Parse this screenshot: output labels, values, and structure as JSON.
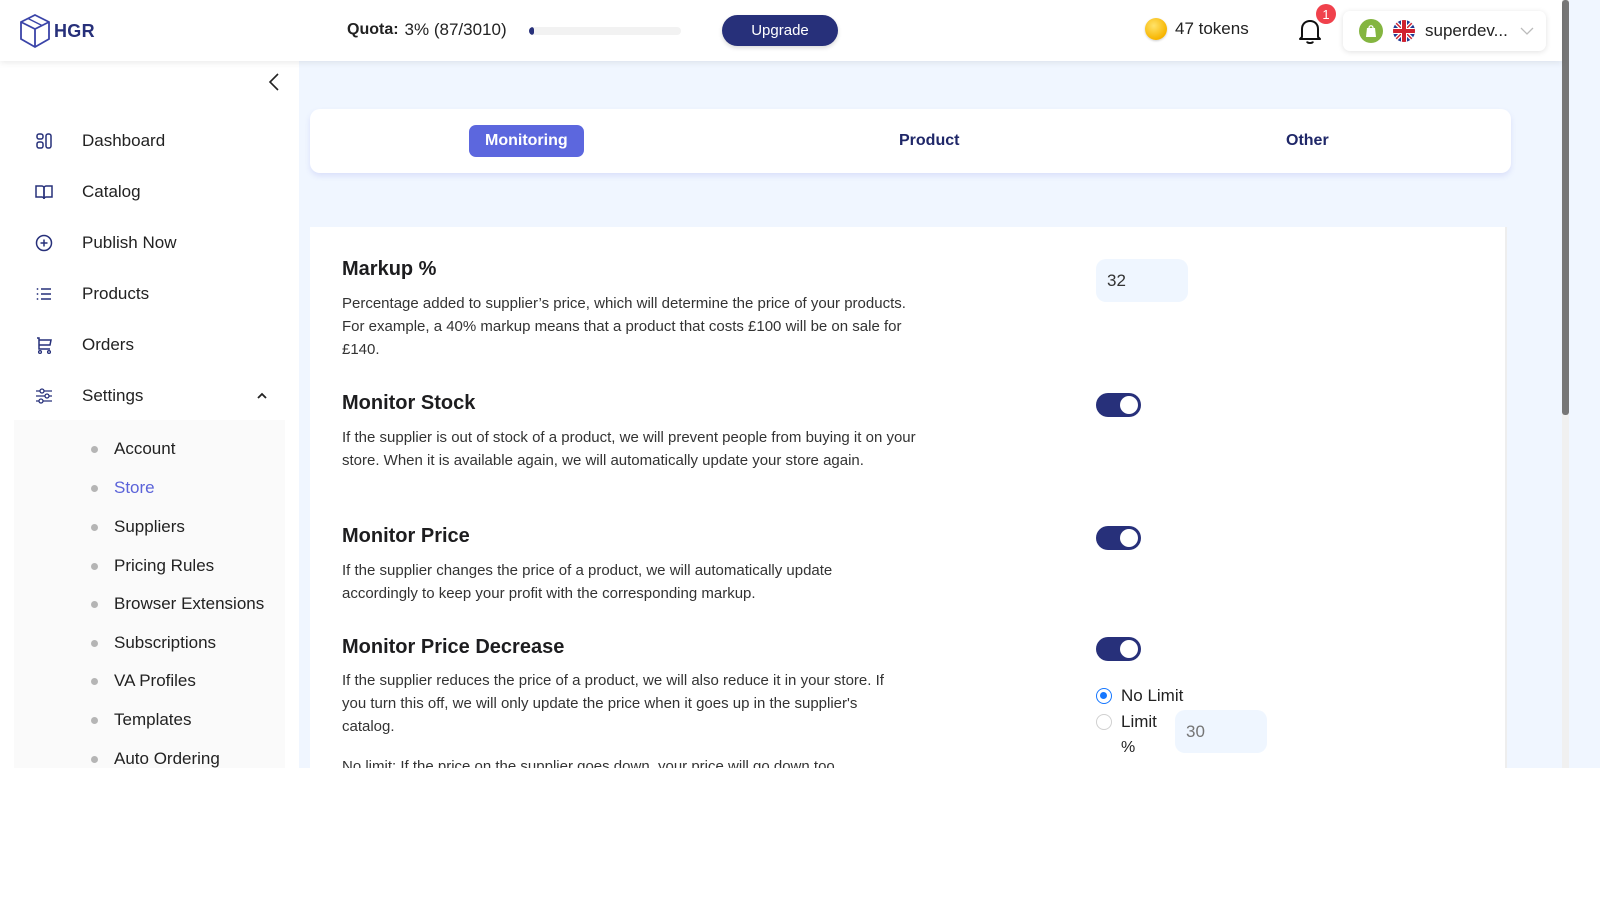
{
  "header": {
    "logo_text": "HGR",
    "quota_label": "Quota:",
    "quota_value": "3% (87/3010)",
    "quota_percent": 3,
    "upgrade_label": "Upgrade",
    "tokens_label": "47 tokens",
    "notification_count": "1",
    "store_name": "superdev..."
  },
  "sidebar": {
    "items": [
      {
        "label": "Dashboard",
        "icon": "dashboard-icon"
      },
      {
        "label": "Catalog",
        "icon": "book-icon"
      },
      {
        "label": "Publish Now",
        "icon": "plus-circle-icon"
      },
      {
        "label": "Products",
        "icon": "list-icon"
      },
      {
        "label": "Orders",
        "icon": "cart-icon"
      },
      {
        "label": "Settings",
        "icon": "sliders-icon",
        "expanded": true
      }
    ],
    "settings_submenu": [
      {
        "label": "Account"
      },
      {
        "label": "Store",
        "active": true
      },
      {
        "label": "Suppliers"
      },
      {
        "label": "Pricing Rules"
      },
      {
        "label": "Browser Extensions"
      },
      {
        "label": "Subscriptions"
      },
      {
        "label": "VA Profiles"
      },
      {
        "label": "Templates"
      },
      {
        "label": "Auto Ordering"
      }
    ]
  },
  "tabs": [
    {
      "label": "Monitoring",
      "active": true
    },
    {
      "label": "Product"
    },
    {
      "label": "Other"
    }
  ],
  "settings": {
    "markup": {
      "title": "Markup %",
      "description": "Percentage added to supplier’s price, which will determine the price of your products. For example, a 40% markup means that a product that costs £100 will be on sale for £140.",
      "value": "32"
    },
    "monitor_stock": {
      "title": "Monitor Stock",
      "description": "If the supplier is out of stock of a product, we will prevent people from buying it on your store. When it is available again, we will automatically update your store again.",
      "enabled": true
    },
    "monitor_price": {
      "title": "Monitor Price",
      "description": "If the supplier changes the price of a product, we will automatically update accordingly to keep your profit with the corresponding markup.",
      "enabled": true
    },
    "monitor_price_decrease": {
      "title": "Monitor Price Decrease",
      "description": "If the supplier reduces the price of a product, we will also reduce it in your store. If you turn this off, we will only update the price when it goes up in the supplier's catalog.",
      "note": "No limit: If the price on the supplier goes down, your price will go down too",
      "enabled": true,
      "options": [
        {
          "label": "No Limit",
          "selected": true
        },
        {
          "label": "Limit",
          "selected": false
        }
      ],
      "limit_unit": "%",
      "limit_placeholder": "30"
    }
  },
  "colors": {
    "brand": "#27307a",
    "accent": "#5c67de",
    "active_sub": "#5b63d9",
    "badge": "#f0414c",
    "radio": "#1677ff"
  }
}
